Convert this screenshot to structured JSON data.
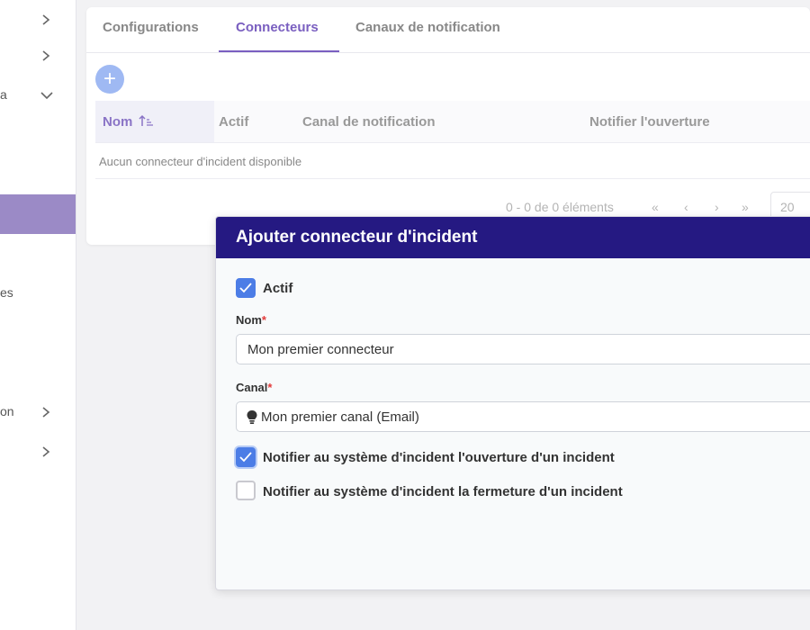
{
  "sidebar": {
    "items": [
      {
        "label": "",
        "icon": "chevron-right-icon"
      },
      {
        "label": "",
        "icon": "chevron-right-icon"
      },
      {
        "label": "a",
        "icon": "chevron-down-icon"
      },
      {
        "label": "es",
        "icon": ""
      },
      {
        "label": "on",
        "icon": "chevron-right-icon"
      },
      {
        "label": "",
        "icon": "chevron-right-icon"
      }
    ]
  },
  "tabs": [
    "Configurations",
    "Connecteurs",
    "Canaux de notification"
  ],
  "active_tab": "Connecteurs",
  "table": {
    "add_label": "+",
    "columns": [
      "Nom",
      "Actif",
      "Canal de notification",
      "Notifier l'ouverture"
    ],
    "sorted_column": "Nom",
    "empty_message": "Aucun connecteur d'incident disponible"
  },
  "pagination": {
    "info": "0 - 0 de 0 éléments",
    "first": "«",
    "prev": "‹",
    "next": "›",
    "last": "»",
    "page_size": "20"
  },
  "modal": {
    "title": "Ajouter connecteur d'incident",
    "actif_label": "Actif",
    "actif_checked": true,
    "nom_label": "Nom",
    "nom_value": "Mon premier connecteur",
    "canal_label": "Canal",
    "canal_value": "Mon premier canal (Email)",
    "required_mark": "*",
    "notify_open_label": "Notifier au système d'incident l'ouverture d'un incident",
    "notify_open_checked": true,
    "notify_close_label": "Notifier au système d'incident la fermeture d'un incident",
    "notify_close_checked": false
  },
  "colors": {
    "accent": "#7a5fc0",
    "modal_header": "#251982",
    "checkbox": "#4c7de6",
    "required": "#e23a3a"
  }
}
